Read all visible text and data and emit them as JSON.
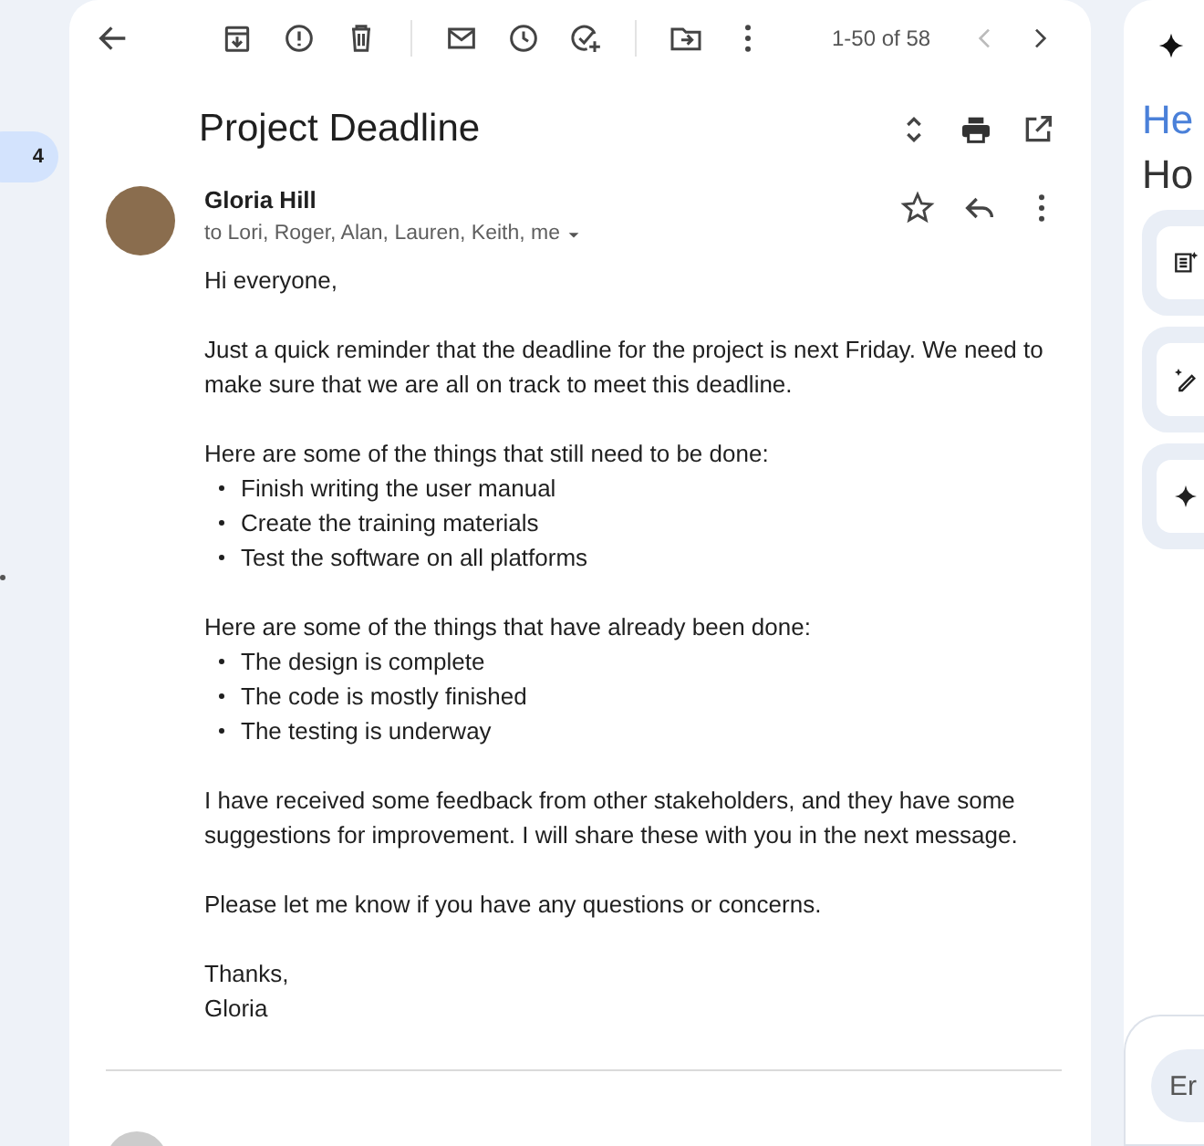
{
  "left_rail": {
    "badge": "4"
  },
  "toolbar": {
    "counter": "1-50 of 58"
  },
  "email": {
    "subject": "Project Deadline",
    "sender": "Gloria Hill",
    "recipients": "to Lori, Roger, Alan, Lauren, Keith, me",
    "body": [
      {
        "kind": "paragraph",
        "text": "Hi everyone,"
      },
      {
        "kind": "paragraph",
        "text": "Just a quick reminder that the deadline for the project is next Friday. We need to make sure that we are all on track to meet this deadline."
      },
      {
        "kind": "paragraph",
        "text": "Here are some of the things that still need to be done:"
      },
      {
        "kind": "list",
        "items": [
          "Finish writing the user manual",
          "Create the training materials",
          "Test the software on all platforms"
        ]
      },
      {
        "kind": "paragraph",
        "text": "Here are some of the things that have already been done:"
      },
      {
        "kind": "list",
        "items": [
          "The design is complete",
          "The code is mostly finished",
          "The testing is underway"
        ]
      },
      {
        "kind": "paragraph",
        "text": "I have received some feedback from other stakeholders, and they have some suggestions for improvement. I will share these with you in the next message."
      },
      {
        "kind": "paragraph",
        "text": "Please let me know if you have any questions or concerns."
      },
      {
        "kind": "signature",
        "lines": [
          "Thanks,",
          "Gloria"
        ]
      }
    ]
  },
  "side_panel": {
    "greeting": "He",
    "subtitle": "Ho",
    "input_placeholder": "Er"
  }
}
